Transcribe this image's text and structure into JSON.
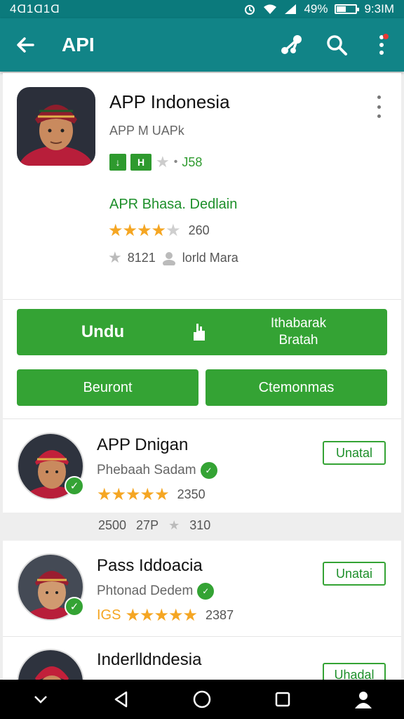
{
  "status_bar": {
    "left_text": "4Ɑ1Ɑ1Ɑ",
    "battery_text": "49%",
    "time": "9:3IM",
    "battery_level": 0.49
  },
  "app_bar": {
    "title": "API"
  },
  "featured": {
    "title": "APP Indonesia",
    "subtitle": "APP M UAPk",
    "badge_1": "↓",
    "badge_2": "H",
    "badge_text": "J58",
    "developer": "APR Bhasa. Dedlain",
    "rating_value": 3.5,
    "rating_count": "260",
    "meta_count": "8121",
    "meta_author": "lorld Mara",
    "install_label": "Undu",
    "install_side_label_1": "Ithabarak",
    "install_side_label_2": "Bratah",
    "secondary_button_1": "Beuront",
    "secondary_button_2": "Ctemonmas"
  },
  "list": [
    {
      "title": "APP Dnigan",
      "subtitle": "Phebaah Sadam",
      "verify_icon": "✓",
      "rating_value": 4.5,
      "rating_count": "2350",
      "button": "Unatal"
    },
    {
      "title": "Pass Iddoacia",
      "subtitle": "Phtonad Dedem",
      "verify_icon": "✓",
      "rating_value": 4.5,
      "rating_prefix": "IGS",
      "rating_count": "2387",
      "button": "Unatai"
    },
    {
      "title": "Inderlldndesia",
      "button": "Uhadal"
    }
  ],
  "meta_strip": {
    "a": "2500",
    "b": "27P",
    "c": "310"
  },
  "colors": {
    "appbar": "#118487",
    "statusbar": "#0b7a7c",
    "accent_green": "#34a334",
    "star": "#f5a623"
  }
}
